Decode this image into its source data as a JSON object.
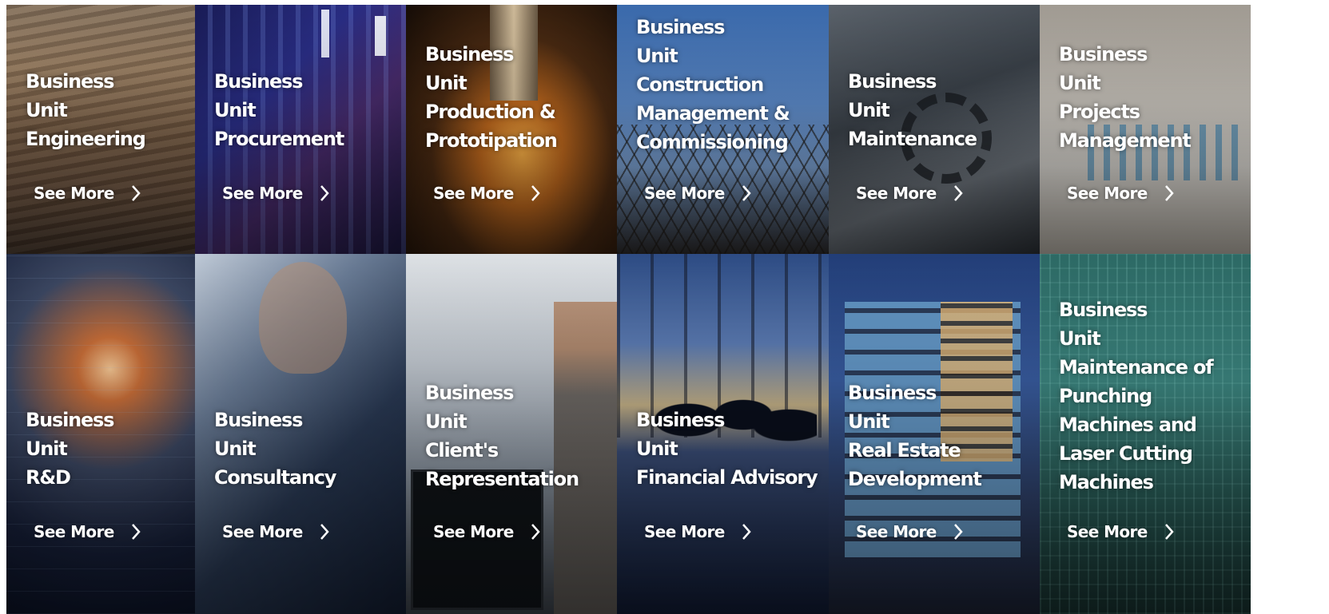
{
  "see_more_label": "See More",
  "tiles": [
    {
      "id": "engineering",
      "lines": [
        "Business",
        "Unit",
        "Engineering"
      ]
    },
    {
      "id": "procurement",
      "lines": [
        "Business",
        "Unit",
        "Procurement"
      ]
    },
    {
      "id": "production",
      "lines": [
        "Business",
        "Unit",
        "Production &",
        "Prototipation"
      ]
    },
    {
      "id": "construction",
      "lines": [
        "Business",
        "Unit",
        "Construction",
        "Management &",
        "Commissioning"
      ]
    },
    {
      "id": "maintenance",
      "lines": [
        "Business",
        "Unit",
        "Maintenance"
      ]
    },
    {
      "id": "projects",
      "lines": [
        "Business",
        "Unit",
        "Projects",
        "Management"
      ]
    },
    {
      "id": "rnd",
      "lines": [
        "Business",
        "Unit",
        "R&D"
      ]
    },
    {
      "id": "consultancy",
      "lines": [
        "Business",
        "Unit",
        "Consultancy"
      ]
    },
    {
      "id": "clients-representation",
      "lines": [
        "Business",
        "Unit",
        "Client's",
        "Representation"
      ]
    },
    {
      "id": "financial-advisory",
      "lines": [
        "Business",
        "Unit",
        "Financial Advisory"
      ]
    },
    {
      "id": "real-estate",
      "lines": [
        "Business",
        "Unit",
        "Real Estate",
        "Development"
      ]
    },
    {
      "id": "punching-laser",
      "lines": [
        "Business",
        "Unit",
        "Maintenance of",
        "Punching",
        "Machines and",
        "Laser Cutting",
        "Machines"
      ]
    }
  ],
  "icons": {
    "see_more": "chevron-right-icon"
  }
}
